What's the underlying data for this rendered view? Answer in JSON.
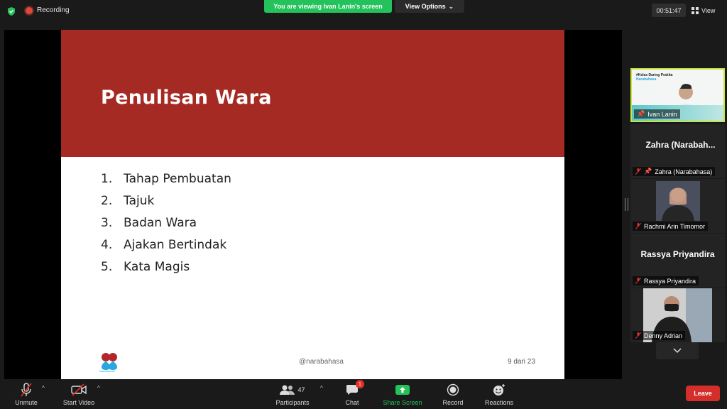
{
  "topbar": {
    "recording_label": "Recording",
    "viewing_banner": "You are viewing Ivan Lanin's screen",
    "view_options_label": "View Options",
    "timer": "00:51:47",
    "view_label": "View"
  },
  "slide": {
    "title": "Penulisan Wara",
    "items": [
      {
        "num": "1.",
        "text": "Tahap Pembuatan"
      },
      {
        "num": "2.",
        "text": "Tajuk"
      },
      {
        "num": "3.",
        "text": "Badan Wara"
      },
      {
        "num": "4.",
        "text": "Ajakan Bertindak"
      },
      {
        "num": "5.",
        "text": "Kata Magis"
      }
    ],
    "handle": "@narabahasa",
    "page": "9 dari 23",
    "logo_text": "Narabahasa"
  },
  "gallery": {
    "tiles": [
      {
        "name": "Ivan Lanin",
        "banner_line1": "#Kelas Daring Prakita",
        "banner_line2": "Narabahasa"
      },
      {
        "name": "Zahra (Narabahasa)",
        "big_name": "Zahra  (Narabah..."
      },
      {
        "name": "Rachmi Arin Timomor"
      },
      {
        "name": "Rassya Priyandira",
        "big_name": "Rassya Priyandira"
      },
      {
        "name": "Denny Adrian"
      }
    ]
  },
  "toolbar": {
    "unmute": "Unmute",
    "start_video": "Start Video",
    "participants": "Participants",
    "participants_count": "47",
    "chat": "Chat",
    "chat_badge": "1",
    "share_screen": "Share Screen",
    "record": "Record",
    "reactions": "Reactions",
    "leave": "Leave"
  },
  "colors": {
    "slide_header": "#a62a24",
    "share_green": "#23c25a",
    "leave_red": "#d32e2a",
    "active_speaker": "#c8e63c"
  }
}
